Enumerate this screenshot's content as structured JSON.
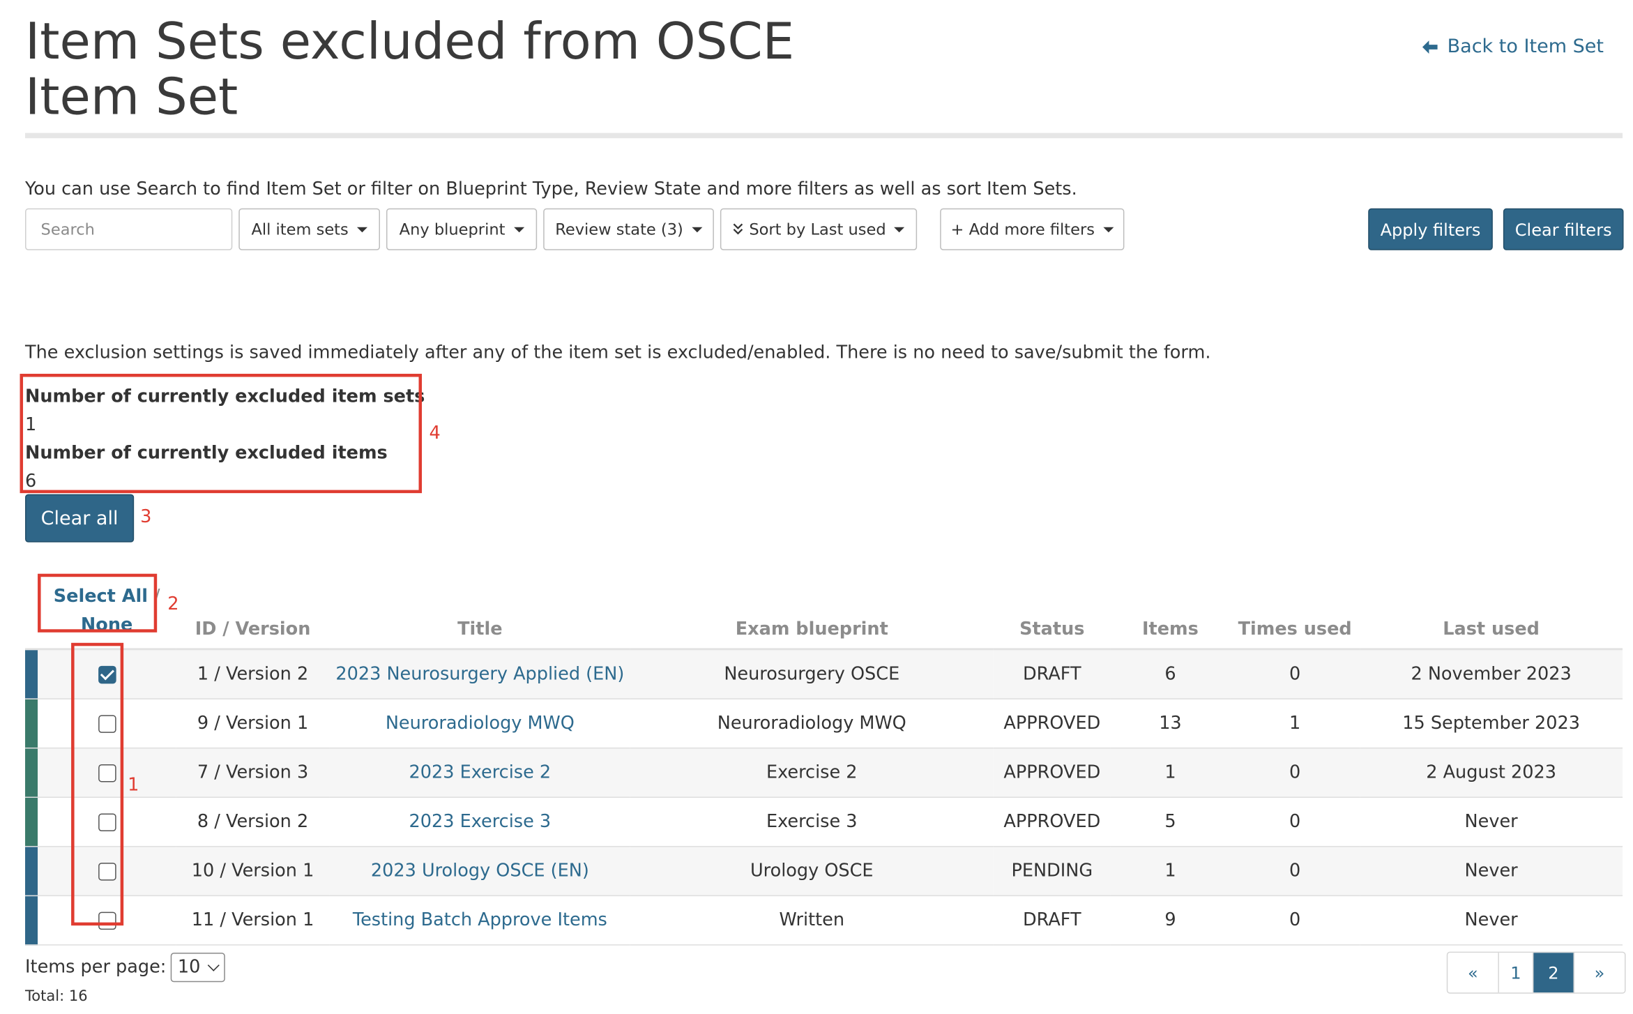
{
  "header": {
    "title": "Item Sets excluded from OSCE Item Set",
    "back_label": "Back to Item Set"
  },
  "filters": {
    "intro": "You can use Search to find Item Set or filter on Blueprint Type, Review State and more filters as well as sort Item Sets.",
    "search_placeholder": "Search",
    "item_sets": "All item sets",
    "blueprint": "Any blueprint",
    "review_state": "Review state (3)",
    "sort": "Sort by Last used",
    "more": "+ Add more filters",
    "apply": "Apply filters",
    "clear": "Clear filters"
  },
  "notice": "The exclusion settings is saved immediately after any of the item set is excluded/enabled. There is no need to save/submit the form.",
  "stats": {
    "excluded_sets_label": "Number of currently excluded item sets",
    "excluded_sets_value": "1",
    "excluded_items_label": "Number of currently excluded items",
    "excluded_items_value": "6"
  },
  "clear_all": "Clear all",
  "annotations": {
    "a1": "1",
    "a2": "2",
    "a3": "3",
    "a4": "4"
  },
  "table": {
    "select_all": "Select All",
    "select_sep": "/",
    "select_none": "None",
    "columns": [
      "ID / Version",
      "Title",
      "Exam blueprint",
      "Status",
      "Items",
      "Times used",
      "Last used"
    ],
    "rows": [
      {
        "id": "1 / Version 2",
        "title": "2023 Neurosurgery Applied (EN)",
        "blueprint": "Neurosurgery OSCE",
        "status": "DRAFT",
        "items": "6",
        "times_used": "0",
        "last_used": "2 November 2023",
        "checked": true,
        "stripe": "#2f6688"
      },
      {
        "id": "9 / Version 1",
        "title": "Neuroradiology MWQ",
        "blueprint": "Neuroradiology MWQ",
        "status": "APPROVED",
        "items": "13",
        "times_used": "1",
        "last_used": "15 September 2023",
        "checked": false,
        "stripe": "#3a7a6a"
      },
      {
        "id": "7 / Version 3",
        "title": "2023 Exercise 2",
        "blueprint": "Exercise 2",
        "status": "APPROVED",
        "items": "1",
        "times_used": "0",
        "last_used": "2 August 2023",
        "checked": false,
        "stripe": "#3a7a6a"
      },
      {
        "id": "8 / Version 2",
        "title": "2023 Exercise 3",
        "blueprint": "Exercise 3",
        "status": "APPROVED",
        "items": "5",
        "times_used": "0",
        "last_used": "Never",
        "checked": false,
        "stripe": "#3a7a6a"
      },
      {
        "id": "10 / Version 1",
        "title": "2023 Urology OSCE (EN)",
        "blueprint": "Urology OSCE",
        "status": "PENDING",
        "items": "1",
        "times_used": "0",
        "last_used": "Never",
        "checked": false,
        "stripe": "#2f6688"
      },
      {
        "id": "11 / Version 1",
        "title": "Testing Batch Approve Items",
        "blueprint": "Written",
        "status": "DRAFT",
        "items": "9",
        "times_used": "0",
        "last_used": "Never",
        "checked": false,
        "stripe": "#2f6688"
      }
    ]
  },
  "footer": {
    "items_per_page_label": "Items per page:",
    "items_per_page_value": "10",
    "total": "Total: 16",
    "pager": [
      "«",
      "1",
      "2",
      "»"
    ],
    "current_page": "2"
  },
  "colors": {
    "primary": "#2f6688",
    "link": "#2d6a8e",
    "approved": "#3a8a5d",
    "annotation": "#e03c31"
  },
  "icons": {
    "back": "arrow-left-icon",
    "checkbox": "checkbox-icon"
  }
}
